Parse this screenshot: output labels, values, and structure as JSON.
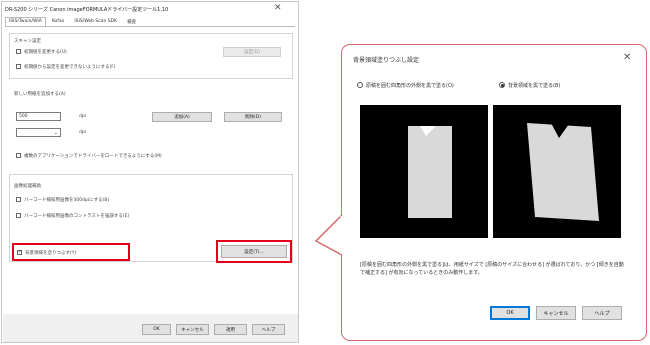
{
  "left_dialog": {
    "title": "DR-S200 シリーズ Canon imageFORMULAドライバー設定ツール1.10",
    "close_glyph": "✕",
    "tabs": [
      {
        "label": "ISIS/Twain/WIA"
      },
      {
        "label": "Kofax"
      },
      {
        "label": "ISIS/Web Scan SDK"
      },
      {
        "label": "検査"
      }
    ],
    "scan_settings": {
      "heading": "スキャン設定",
      "option1": "初期値を変更する(U)",
      "option1_button": "設定(D)",
      "option2": "初期値から設定を変更できないようにする(F)"
    },
    "paper_size": {
      "heading": "新しい用紙を追加する(A)",
      "input_value": "500",
      "unit1": "dpi",
      "add_button": "追加(A)",
      "delete_button": "削除(D)",
      "unit2": "dpi",
      "option": "複数のアプリケーションでドライバーをロードできるようにする(M)"
    },
    "image_processing": {
      "heading": "画像処理補助",
      "option1": "バーコード検知用画像を300dpiにする(B)",
      "option2": "バーコード検知用画像のコントラストを強調する(E)",
      "highlight_option": "背景領域を塗りつぶす(Y)",
      "highlight_checked": "✓",
      "settings_button": "設定(T)..."
    },
    "footer": {
      "ok": "OK",
      "cancel": "キャンセル",
      "apply": "適用",
      "help": "ヘルプ"
    }
  },
  "right_dialog": {
    "title": "背景領域塗りつぶし設定",
    "close_glyph": "✕",
    "radio1": "原稿を囲む四角形の外側を黒で塗る(O)",
    "radio2": "背景領域を黒で塗る(B)",
    "radio_selected": 2,
    "description": "[原稿を囲む四角形の外側を黒で塗る]は、用紙サイズで [原稿のサイズに合わせる] が選ばれており、かつ [傾きを自動で補正する] が有効になっているときのみ動作します。",
    "ok": "OK",
    "cancel": "キャンセル",
    "help": "ヘルプ"
  },
  "colors": {
    "highlight_red": "#e0001b",
    "callout_border": "#d86a6a",
    "primary_button_border": "#0078d7"
  }
}
